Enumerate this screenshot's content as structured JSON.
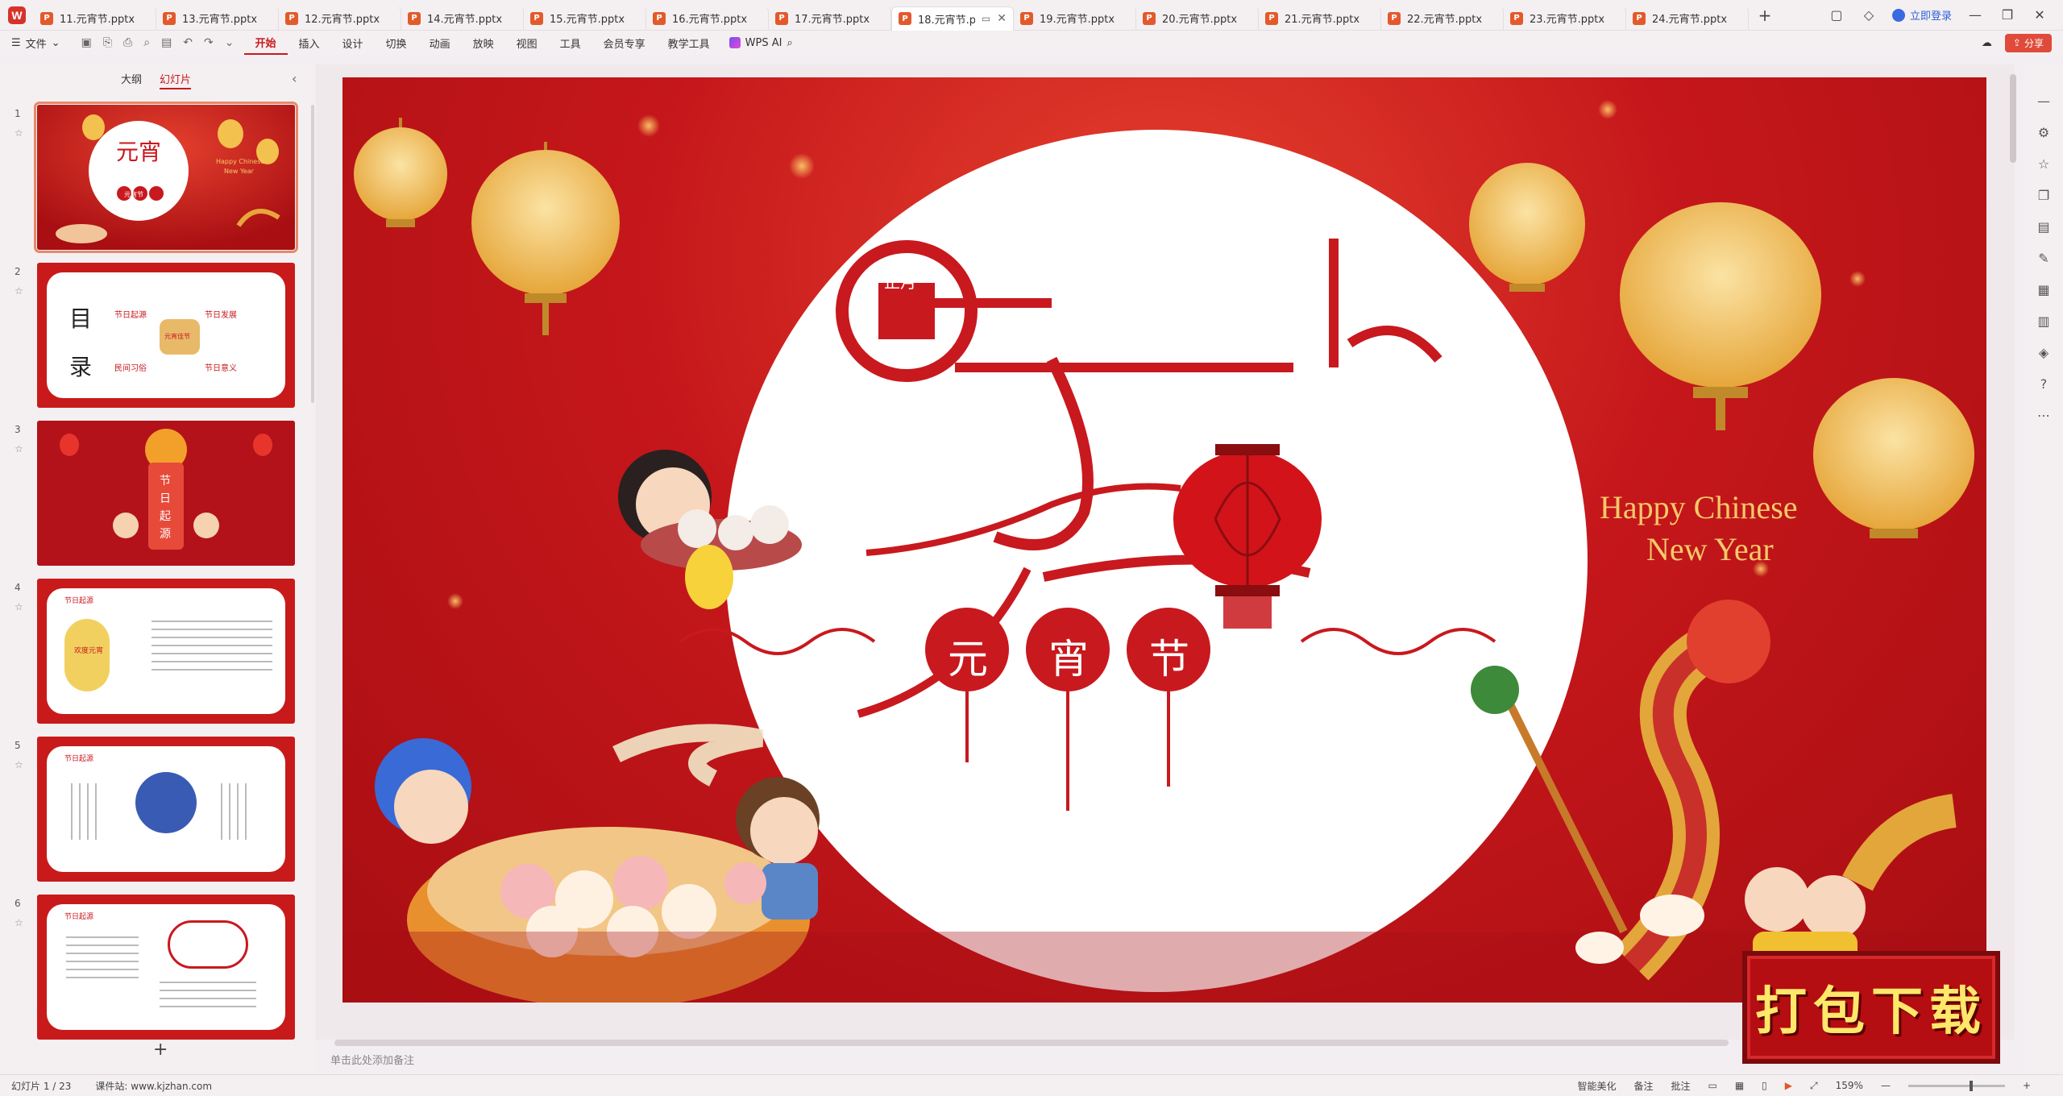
{
  "tabs": [
    {
      "label": "11.元宵节.pptx"
    },
    {
      "label": "13.元宵节.pptx"
    },
    {
      "label": "12.元宵节.pptx"
    },
    {
      "label": "14.元宵节.pptx"
    },
    {
      "label": "15.元宵节.pptx"
    },
    {
      "label": "16.元宵节.pptx"
    },
    {
      "label": "17.元宵节.pptx"
    },
    {
      "label": "18.元宵节.p"
    },
    {
      "label": "19.元宵节.pptx"
    },
    {
      "label": "20.元宵节.pptx"
    },
    {
      "label": "21.元宵节.pptx"
    },
    {
      "label": "22.元宵节.pptx"
    },
    {
      "label": "23.元宵节.pptx"
    },
    {
      "label": "24.元宵节.pptx"
    }
  ],
  "tab_add": "+",
  "login_label": "立即登录",
  "ribbon": {
    "file_label": "文件",
    "menus": [
      "开始",
      "插入",
      "设计",
      "切换",
      "动画",
      "放映",
      "视图",
      "工具",
      "会员专享",
      "教学工具"
    ],
    "wps_ai": "WPS AI",
    "share": "分享"
  },
  "panel": {
    "outline_tab": "大纲",
    "slides_tab": "幻灯片",
    "add": "+"
  },
  "thumbnails": [
    {
      "num": "1",
      "texts": [
        "Happy Chinese",
        "New Year",
        "元宵节"
      ]
    },
    {
      "num": "2",
      "texts": [
        "目",
        "录",
        "节日起源",
        "节日发展",
        "民间习俗",
        "节日意义",
        "元宵佳节"
      ]
    },
    {
      "num": "3",
      "texts": [
        "节",
        "日",
        "起",
        "源"
      ]
    },
    {
      "num": "4",
      "texts": [
        "节日起源",
        "欢度元宵"
      ]
    },
    {
      "num": "5",
      "texts": [
        "节日起源"
      ]
    },
    {
      "num": "6",
      "texts": [
        "节日起源"
      ]
    }
  ],
  "slide": {
    "title_small": "正月",
    "title_big": "元宵",
    "badge_chars": [
      "元",
      "宵",
      "节"
    ],
    "greeting_line1": "Happy Chinese",
    "greeting_line2": "New Year"
  },
  "notes_placeholder": "单击此处添加备注",
  "status": {
    "slide_counter": "幻灯片 1 / 23",
    "source": "课件站: www.kjzhan.com",
    "smart": "智能美化",
    "notes": "备注",
    "comments": "批注",
    "zoom": "159%"
  },
  "download_badge": "打包下载",
  "colors": {
    "accent": "#c8191e",
    "slide_red": "#c5171b",
    "lantern_gold": "#f2c14e"
  }
}
